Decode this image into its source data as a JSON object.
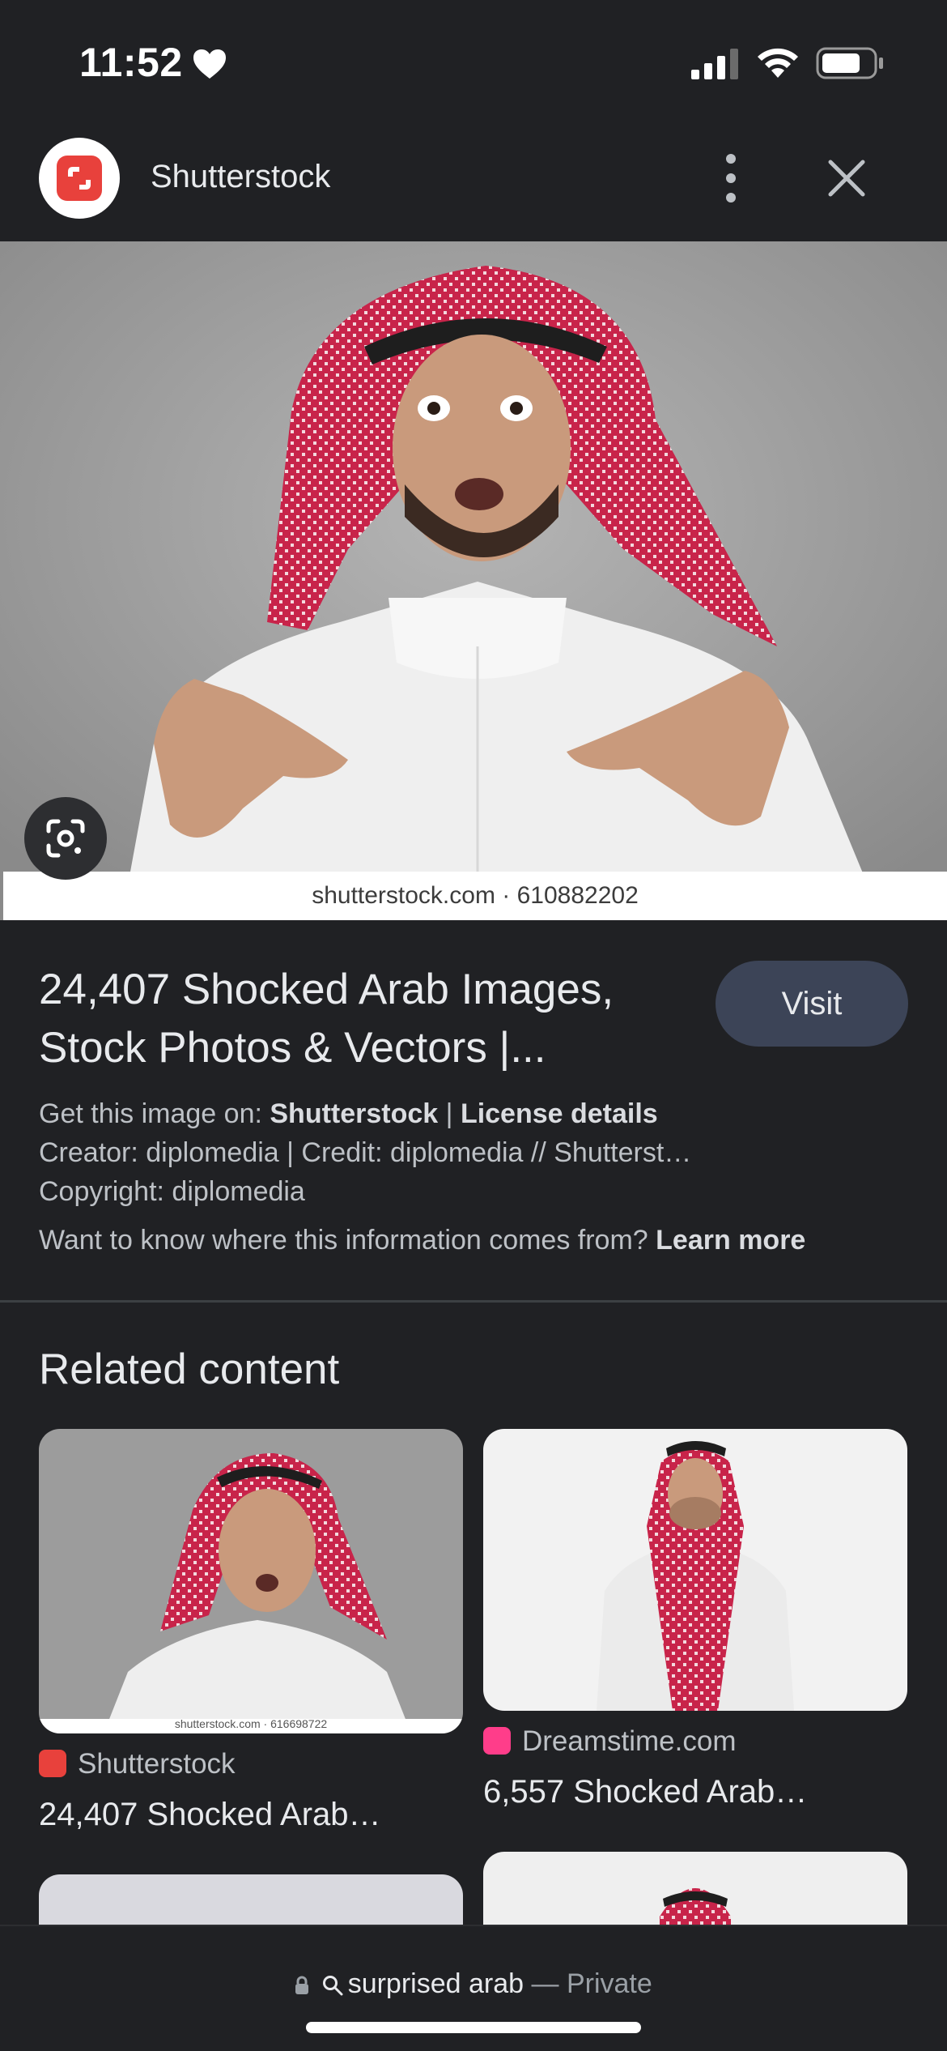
{
  "status_bar": {
    "time": "11:52",
    "icons": [
      "heart-icon",
      "cellular-signal-icon",
      "wifi-icon",
      "battery-icon"
    ]
  },
  "header": {
    "site_name": "Shutterstock",
    "icons": [
      "shutterstock-logo-icon",
      "more-vert-icon",
      "close-icon"
    ]
  },
  "hero": {
    "watermark": "shutterstock.com · 610882202",
    "lens_icon": "google-lens-icon"
  },
  "result": {
    "title_line1": "24,407 Shocked Arab Images,",
    "title_line2": "Stock Photos & Vectors |...",
    "visit_label": "Visit",
    "get_image_prefix": "Get this image on: ",
    "get_image_source": "Shutterstock",
    "separator": " | ",
    "license_details": "License details",
    "creator_line": "Creator: diplomedia | Credit: diplomedia // Shutterst…",
    "copyright_line": "Copyright: diplomedia",
    "info_question": "Want to know where this information comes from? ",
    "learn_more": "Learn more"
  },
  "related": {
    "heading": "Related content",
    "items": [
      {
        "source": "Shutterstock",
        "title": "24,407 Shocked Arab…",
        "watermark": "shutterstock.com · 616698722",
        "favicon_color": "#e8413c"
      },
      {
        "source": "Dreamstime.com",
        "title": "6,557 Shocked Arab…",
        "favicon_color": "#ff3d8a"
      }
    ]
  },
  "bottom_bar": {
    "query": "surprised arab",
    "dash": " — ",
    "mode": "Private",
    "icons": [
      "lock-icon",
      "search-icon"
    ]
  },
  "colors": {
    "background": "#202124",
    "visit_button": "#3c4457",
    "shutterstock_red": "#e8413c"
  }
}
